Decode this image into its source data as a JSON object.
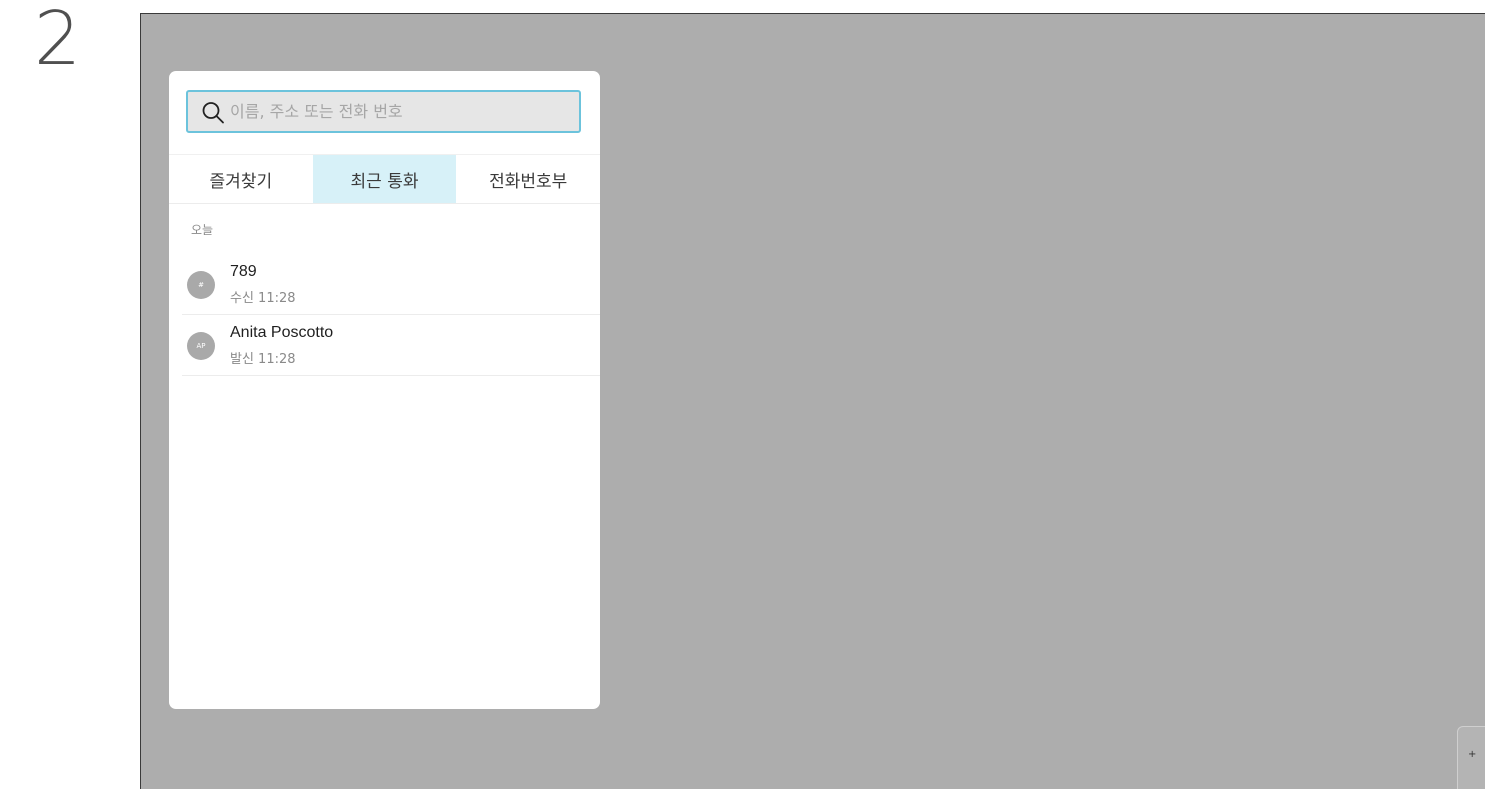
{
  "step_number": "2",
  "search": {
    "placeholder": "이름, 주소 또는 전화 번호",
    "value": ""
  },
  "tabs": [
    {
      "label": "즐겨찾기",
      "active": false
    },
    {
      "label": "최근 통화",
      "active": true
    },
    {
      "label": "전화번호부",
      "active": false
    }
  ],
  "section_label": "오늘",
  "calls": [
    {
      "avatar": "#",
      "name": "789",
      "detail": "수신 11:28"
    },
    {
      "avatar": "AP",
      "name": "Anita Poscotto",
      "detail": "발신 11:28"
    }
  ],
  "corner_button": {
    "glyph": "+"
  },
  "colors": {
    "screen_bg": "#adadad",
    "panel_bg": "#ffffff",
    "active_tab_bg": "#d7f1f8",
    "search_border": "#6cc3dc",
    "avatar_bg": "#a9a9a9"
  }
}
